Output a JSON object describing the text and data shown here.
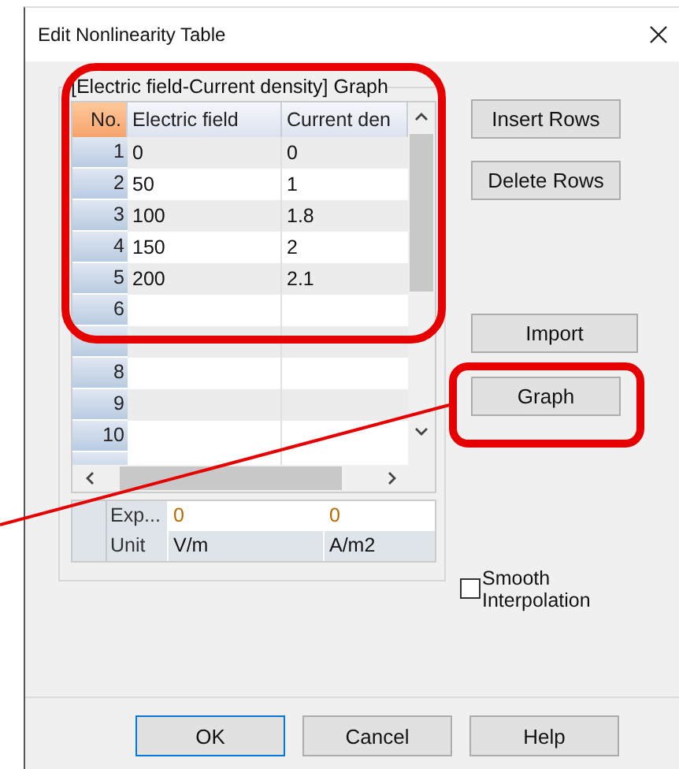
{
  "window": {
    "title": "Edit Nonlinearity Table"
  },
  "group": {
    "title": "[Electric field-Current density] Graph"
  },
  "table": {
    "columns": [
      "No.",
      "Electric field",
      "Current den"
    ],
    "rows": [
      {
        "no": "1",
        "cells": [
          "0",
          "0"
        ]
      },
      {
        "no": "2",
        "cells": [
          "50",
          "1"
        ]
      },
      {
        "no": "3",
        "cells": [
          "100",
          "1.8"
        ]
      },
      {
        "no": "4",
        "cells": [
          "150",
          "2"
        ]
      },
      {
        "no": "5",
        "cells": [
          "200",
          "2.1"
        ]
      },
      {
        "no": "6"
      },
      {},
      {
        "no": "8"
      },
      {
        "no": "9"
      },
      {
        "no": "10"
      }
    ]
  },
  "units_table": {
    "rows": [
      {
        "label": "Exp...",
        "values": [
          "0",
          "0"
        ]
      },
      {
        "label": "Unit",
        "values": [
          "V/m",
          "A/m2"
        ]
      }
    ]
  },
  "side_buttons": [
    [
      "Insert Rows",
      "Delete Rows"
    ],
    [
      "Import",
      "Graph"
    ]
  ],
  "smooth_interpolation": {
    "label": "Smooth Interpolation",
    "checked": false
  },
  "buttons": [
    {
      "label": "OK",
      "default": true
    },
    {
      "label": "Cancel",
      "default": false
    },
    {
      "label": "Help",
      "default": false
    }
  ]
}
